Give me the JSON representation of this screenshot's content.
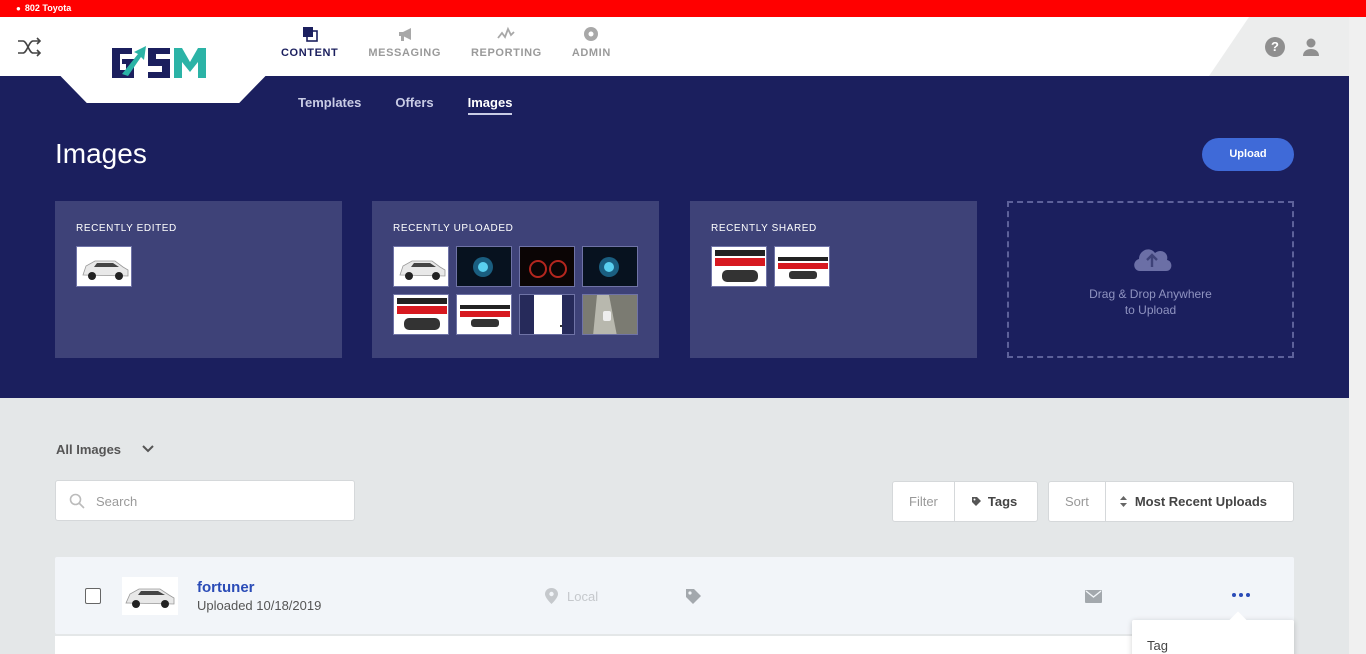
{
  "location_bar": {
    "label": "802 Toyota",
    "color": "#ff0000"
  },
  "nav": {
    "items": [
      {
        "label": "CONTENT",
        "icon": "content-icon",
        "active": true
      },
      {
        "label": "MESSAGING",
        "icon": "megaphone-icon",
        "active": false
      },
      {
        "label": "REPORTING",
        "icon": "chart-line-icon",
        "active": false
      },
      {
        "label": "ADMIN",
        "icon": "gear-icon",
        "active": false
      }
    ]
  },
  "subnav": {
    "items": [
      {
        "label": "Templates",
        "active": false
      },
      {
        "label": "Offers",
        "active": false
      },
      {
        "label": "Images",
        "active": true
      }
    ]
  },
  "page": {
    "title": "Images",
    "upload_label": "Upload"
  },
  "panels": {
    "recently_edited": {
      "title": "RECENTLY EDITED"
    },
    "recently_uploaded": {
      "title": "RECENTLY UPLOADED"
    },
    "recently_shared": {
      "title": "RECENTLY SHARED"
    },
    "dropzone": {
      "line1": "Drag & Drop Anywhere",
      "line2": "to Upload"
    }
  },
  "toolbar": {
    "view_label": "All Images",
    "search_placeholder": "Search",
    "filter_label": "Filter",
    "tags_label": "Tags",
    "sort_label": "Sort",
    "sort_value": "Most Recent Uploads"
  },
  "images": [
    {
      "name": "fortuner",
      "uploaded": "Uploaded 10/18/2019",
      "location": "Local"
    }
  ],
  "context_menu": {
    "items": [
      "Tag"
    ]
  },
  "colors": {
    "hero": "#1b1f5e",
    "card": "#3e4278",
    "accent": "#3f6ad8",
    "link": "#2a4bb7"
  }
}
